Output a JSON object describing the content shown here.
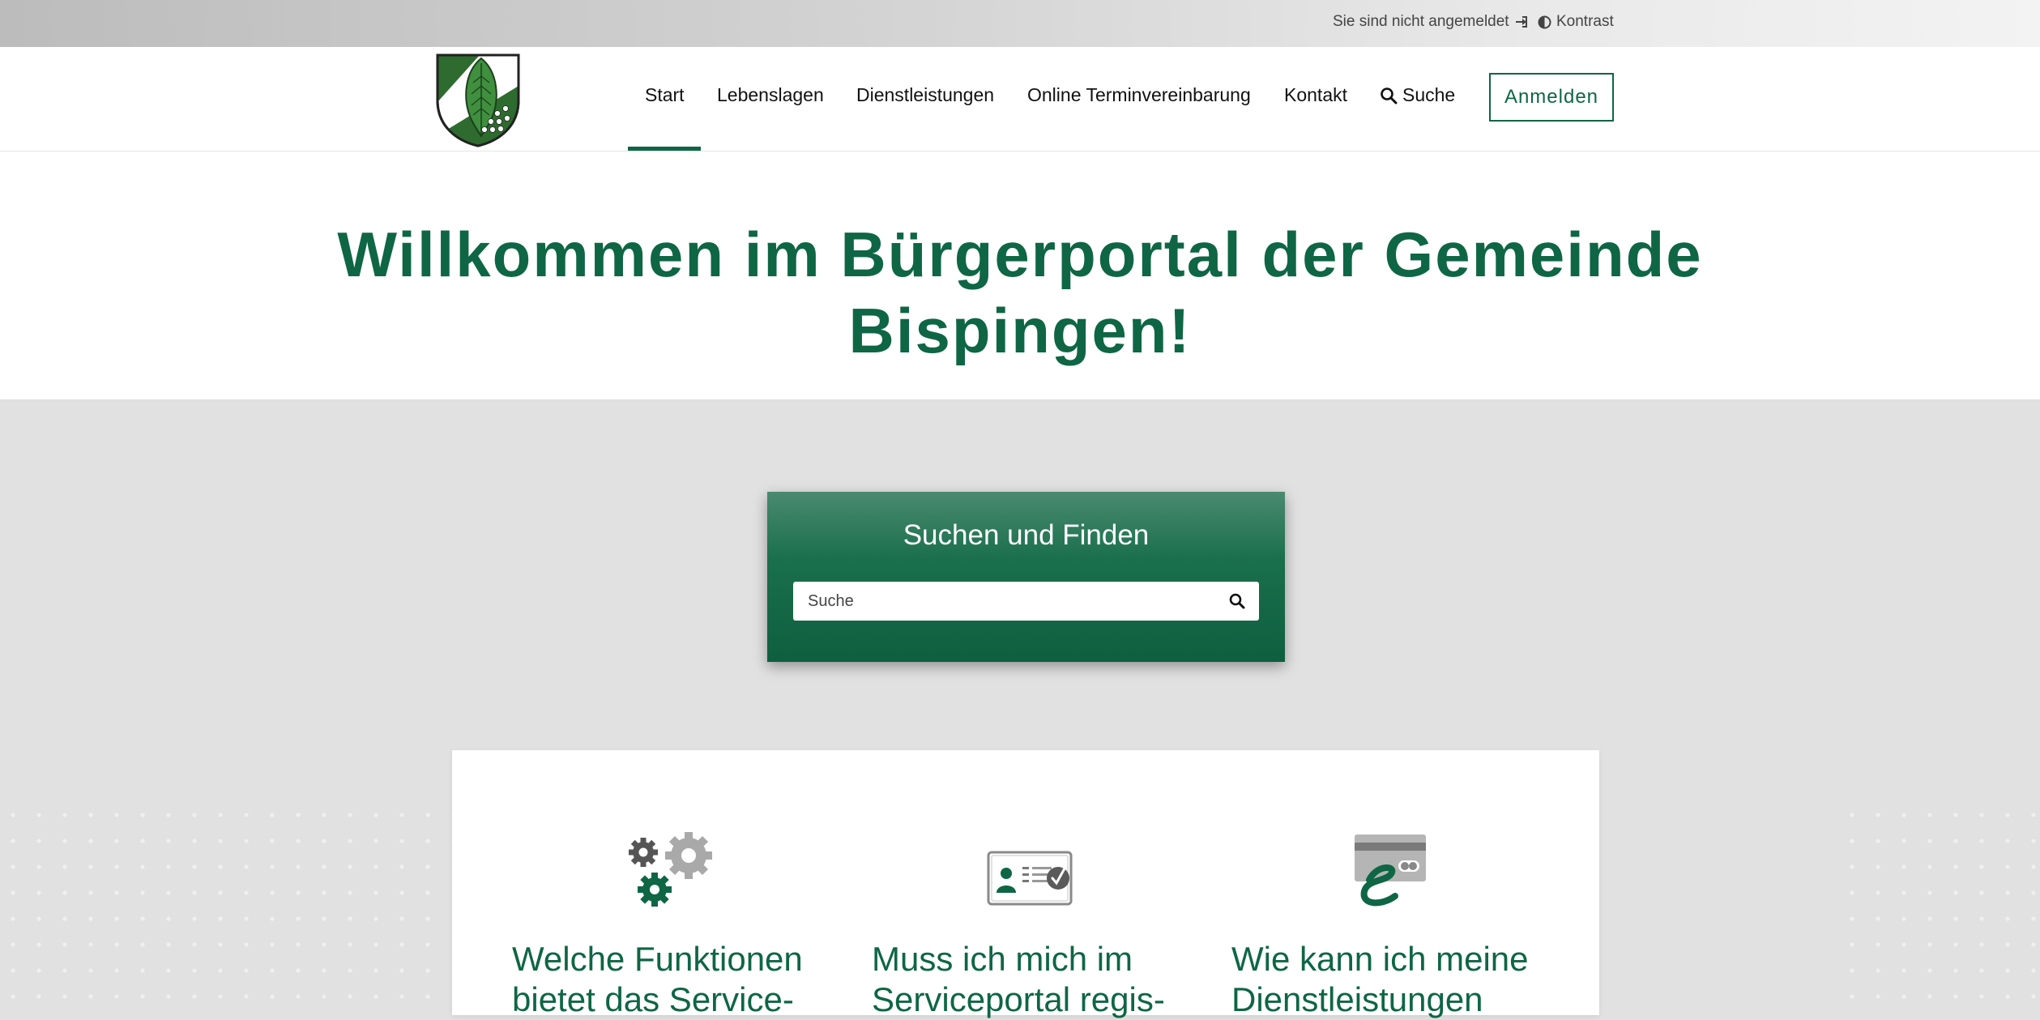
{
  "utility_bar": {
    "login_status": "Sie sind nicht angemeldet",
    "contrast_label": "Kontrast"
  },
  "navbar": {
    "items": [
      {
        "label": "Start",
        "active": true
      },
      {
        "label": "Lebenslagen"
      },
      {
        "label": "Dienstleistungen"
      },
      {
        "label": "Online Terminvereinbarung"
      },
      {
        "label": "Kontakt"
      },
      {
        "label": "Suche",
        "icon": "search-icon"
      }
    ],
    "login_button": "Anmelden"
  },
  "hero": {
    "title_line1": "Willkommen im Bürgerportal der Gemeinde",
    "title_line2": "Bispingen!"
  },
  "search_card": {
    "title": "Suchen und Finden",
    "placeholder": "Suche"
  },
  "features": [
    {
      "icon": "gears-icon",
      "title_line1": "Welche Funktionen",
      "title_line2": "bietet das Service-"
    },
    {
      "icon": "id-card-check-icon",
      "title_line1": "Muss ich mich im",
      "title_line2": "Serviceportal regis-"
    },
    {
      "icon": "epayment-card-icon",
      "title_line1": "Wie kann ich meine",
      "title_line2": "Dienstleistungen"
    }
  ],
  "colors": {
    "brand_green": "#0e6645",
    "background_gray": "#e1e1e1"
  }
}
